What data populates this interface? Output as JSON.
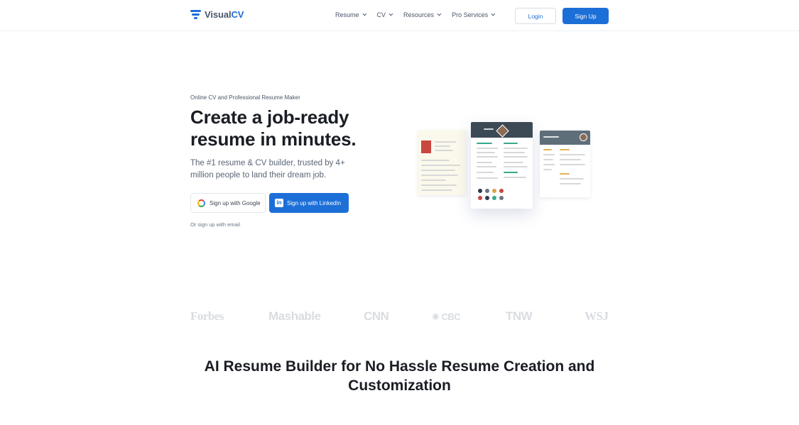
{
  "header": {
    "logo_prefix": "Visual",
    "logo_suffix": "CV",
    "nav": [
      {
        "label": "Resume"
      },
      {
        "label": "CV"
      },
      {
        "label": "Resources"
      },
      {
        "label": "Pro Services"
      }
    ],
    "login_label": "Login",
    "signup_label": "Sign Up"
  },
  "hero": {
    "eyebrow": "Online CV and Professional Resume Maker",
    "title_line1": "Create a job-ready",
    "title_line2": "resume in minutes.",
    "subtitle": "The #1 resume & CV builder, trusted by 4+ million people to land their dream job.",
    "google_label": "Sign up with Google",
    "linkedin_label": "Sign up with LinkedIn",
    "email_label": "Or sign up with email"
  },
  "press": [
    "Forbes",
    "Mashable",
    "CNN",
    "CBC",
    "TNW",
    "WSJ"
  ],
  "section": {
    "title": "AI Resume Builder for No Hassle Resume Creation and Customization"
  },
  "colors": {
    "brand": "#1d6fd8",
    "text": "#1a1d24",
    "muted": "#5b6575"
  }
}
